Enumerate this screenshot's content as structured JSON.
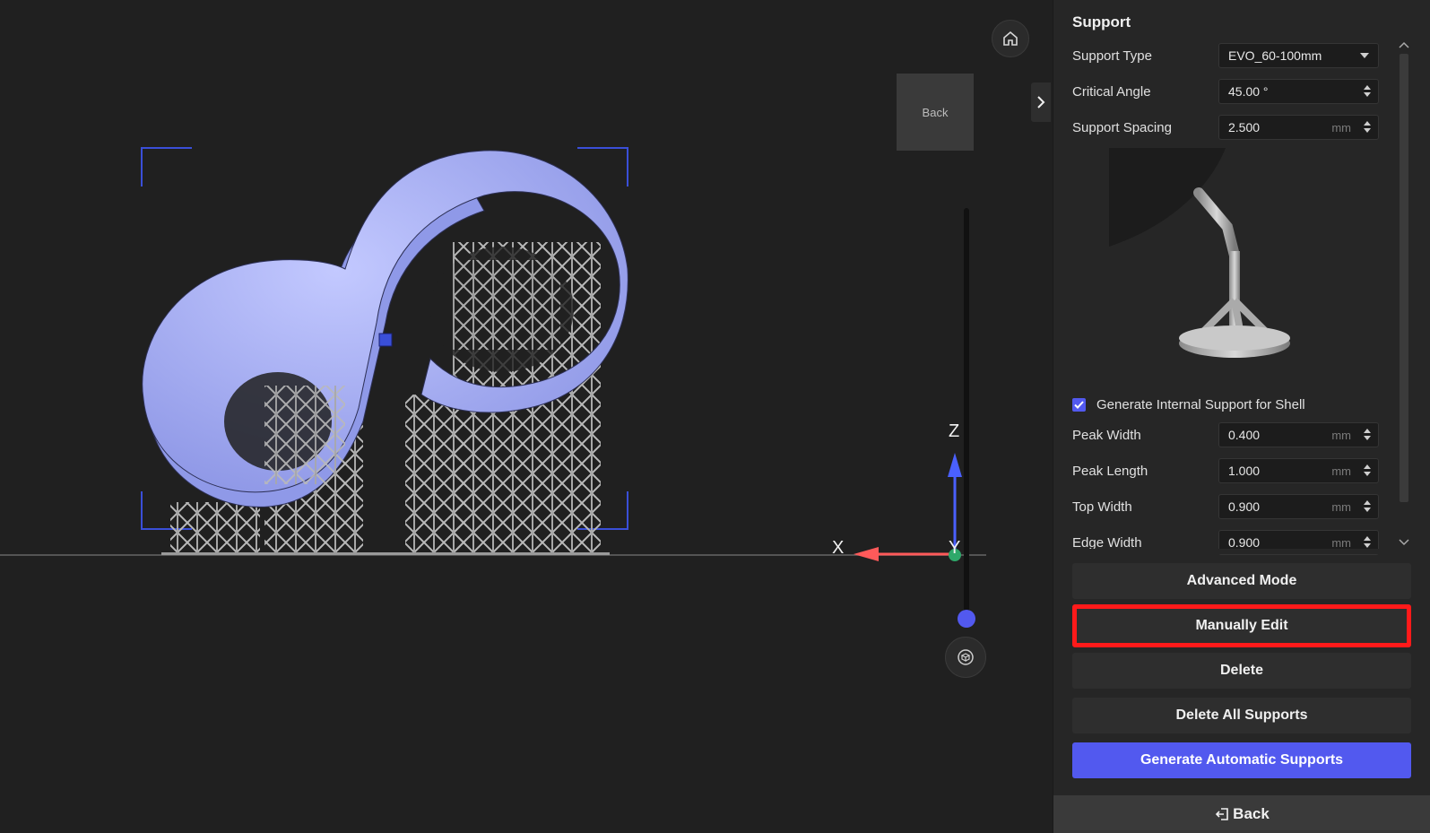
{
  "viewport": {
    "back_box_label": "Back",
    "axis": {
      "x": "X",
      "y": "Y",
      "z": "Z"
    }
  },
  "panel": {
    "title": "Support",
    "support_type": {
      "label": "Support Type",
      "value": "EVO_60-100mm"
    },
    "critical_angle": {
      "label": "Critical Angle",
      "value": "45.00 °"
    },
    "support_spacing": {
      "label": "Support Spacing",
      "value": "2.500",
      "unit": "mm"
    },
    "internal_support": {
      "label": "Generate Internal Support for Shell",
      "checked": true
    },
    "peak_width": {
      "label": "Peak Width",
      "value": "0.400",
      "unit": "mm"
    },
    "peak_length": {
      "label": "Peak Length",
      "value": "1.000",
      "unit": "mm"
    },
    "top_width": {
      "label": "Top Width",
      "value": "0.900",
      "unit": "mm"
    },
    "edge_width": {
      "label": "Edge Width",
      "value": "0.900",
      "unit": "mm"
    }
  },
  "buttons": {
    "advanced_mode": "Advanced Mode",
    "manually_edit": "Manually Edit",
    "delete": "Delete",
    "delete_all": "Delete All Supports",
    "generate_auto": "Generate Automatic Supports",
    "back": "Back"
  },
  "colors": {
    "accent": "#5259ef",
    "highlight": "#ff1a1a",
    "model": "#a9b2f5"
  }
}
